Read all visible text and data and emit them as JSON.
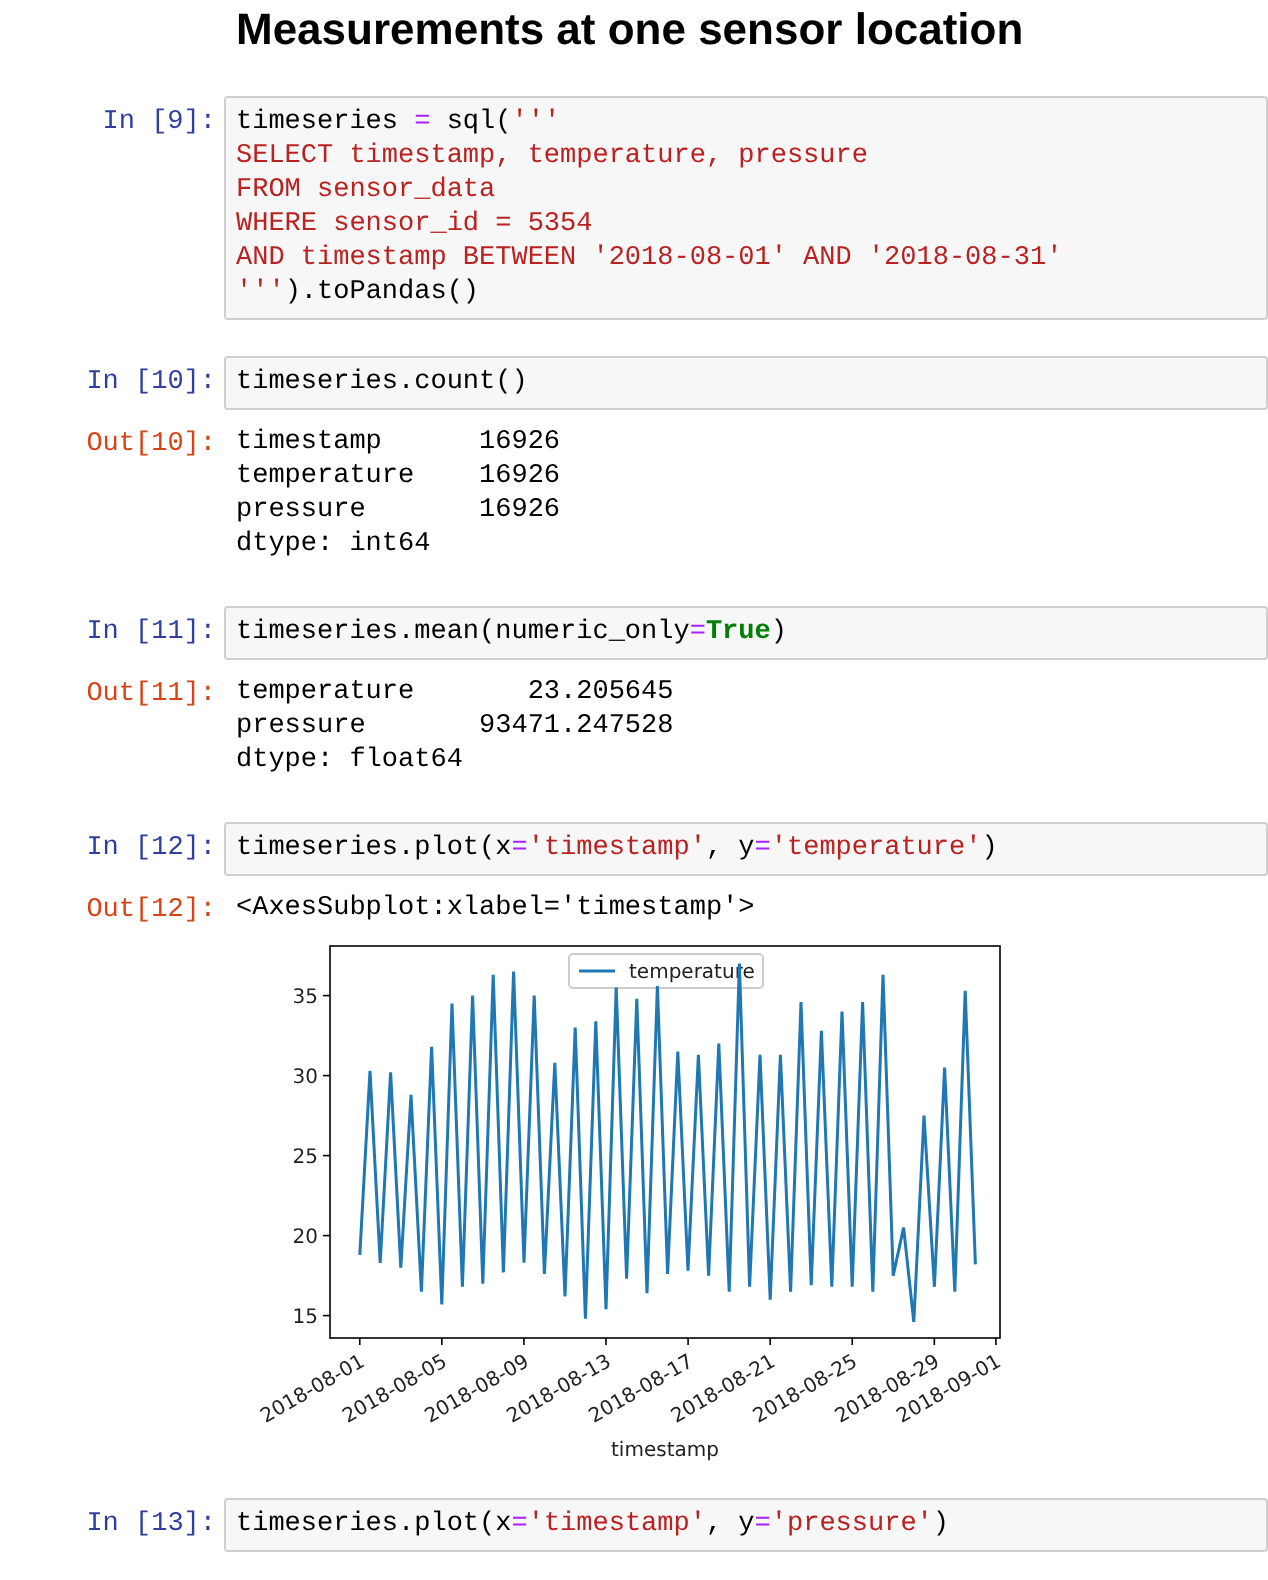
{
  "title": "Measurements at one sensor location",
  "cells": [
    {
      "kind": "input",
      "prompt": "In [9]:",
      "lines": [
        [
          {
            "kind": "plain",
            "text": "timeseries "
          },
          {
            "kind": "op",
            "text": "="
          },
          {
            "kind": "plain",
            "text": " sql("
          },
          {
            "kind": "string",
            "text": "'''"
          }
        ],
        [
          {
            "kind": "string",
            "text": "SELECT timestamp, temperature, pressure"
          }
        ],
        [
          {
            "kind": "string",
            "text": "FROM sensor_data"
          }
        ],
        [
          {
            "kind": "string",
            "text": "WHERE sensor_id = 5354"
          }
        ],
        [
          {
            "kind": "string",
            "text": "AND timestamp BETWEEN '2018-08-01' AND '2018-08-31'"
          }
        ],
        [
          {
            "kind": "string",
            "text": "'''"
          },
          {
            "kind": "plain",
            "text": ").toPandas()"
          }
        ]
      ]
    },
    {
      "kind": "input",
      "prompt": "In [10]:",
      "lines": [
        [
          {
            "kind": "plain",
            "text": "timeseries.count()"
          }
        ]
      ]
    },
    {
      "kind": "output",
      "prompt": "Out[10]:",
      "lines": [
        "timestamp      16926",
        "temperature    16926",
        "pressure       16926",
        "dtype: int64"
      ]
    },
    {
      "kind": "input",
      "prompt": "In [11]:",
      "lines": [
        [
          {
            "kind": "plain",
            "text": "timeseries.mean(numeric_only"
          },
          {
            "kind": "op",
            "text": "="
          },
          {
            "kind": "keyword",
            "text": "True"
          },
          {
            "kind": "plain",
            "text": ")"
          }
        ]
      ]
    },
    {
      "kind": "output",
      "prompt": "Out[11]:",
      "lines": [
        "temperature       23.205645",
        "pressure       93471.247528",
        "dtype: float64"
      ]
    },
    {
      "kind": "input",
      "prompt": "In [12]:",
      "lines": [
        [
          {
            "kind": "plain",
            "text": "timeseries.plot(x"
          },
          {
            "kind": "op",
            "text": "="
          },
          {
            "kind": "string",
            "text": "'timestamp'"
          },
          {
            "kind": "plain",
            "text": ", y"
          },
          {
            "kind": "op",
            "text": "="
          },
          {
            "kind": "string",
            "text": "'temperature'"
          },
          {
            "kind": "plain",
            "text": ")"
          }
        ]
      ]
    },
    {
      "kind": "output",
      "prompt": "Out[12]:",
      "lines": [
        "<AxesSubplot:xlabel='timestamp'>"
      ]
    },
    {
      "kind": "plot",
      "chart_data": {
        "type": "line",
        "xlabel": "timestamp",
        "categories": [
          "2018-08-01",
          null,
          null,
          null,
          null,
          null,
          null,
          null,
          "2018-08-05",
          null,
          null,
          null,
          null,
          null,
          null,
          null,
          "2018-08-09",
          null,
          null,
          null,
          null,
          null,
          null,
          null,
          "2018-08-13",
          null,
          null,
          null,
          null,
          null,
          null,
          null,
          "2018-08-17",
          null,
          null,
          null,
          null,
          null,
          null,
          null,
          "2018-08-21",
          null,
          null,
          null,
          null,
          null,
          null,
          null,
          "2018-08-25",
          null,
          null,
          null,
          null,
          null,
          null,
          null,
          "2018-08-29",
          null,
          null,
          null,
          null,
          null,
          "2018-09-01"
        ],
        "series": [
          {
            "name": "temperature",
            "color": "#1f77b4",
            "values": [
              18.8,
              30.3,
              18.3,
              30.2,
              18.0,
              28.8,
              16.5,
              31.8,
              15.7,
              34.5,
              16.8,
              35.0,
              17.0,
              36.3,
              17.7,
              36.5,
              18.3,
              35.0,
              17.6,
              30.8,
              16.2,
              33.0,
              14.8,
              33.4,
              15.4,
              35.5,
              17.3,
              34.8,
              16.4,
              35.6,
              17.6,
              31.5,
              17.8,
              31.3,
              17.5,
              32.0,
              16.5,
              37.0,
              16.8,
              31.3,
              16.0,
              31.3,
              16.5,
              34.6,
              16.9,
              32.8,
              16.8,
              34.0,
              16.8,
              34.6,
              16.5,
              36.3,
              17.5,
              20.5,
              14.6,
              27.5,
              16.8,
              30.5,
              16.5,
              35.3,
              18.2,
              null,
              null
            ]
          }
        ],
        "ylim": [
          13.6,
          38.1
        ],
        "yticks": [
          15,
          20,
          25,
          30,
          35
        ]
      }
    },
    {
      "kind": "input",
      "prompt": "In [13]:",
      "lines": [
        [
          {
            "kind": "plain",
            "text": "timeseries.plot(x"
          },
          {
            "kind": "op",
            "text": "="
          },
          {
            "kind": "string",
            "text": "'timestamp'"
          },
          {
            "kind": "plain",
            "text": ", y"
          },
          {
            "kind": "op",
            "text": "="
          },
          {
            "kind": "string",
            "text": "'pressure'"
          },
          {
            "kind": "plain",
            "text": ")"
          }
        ]
      ]
    }
  ]
}
